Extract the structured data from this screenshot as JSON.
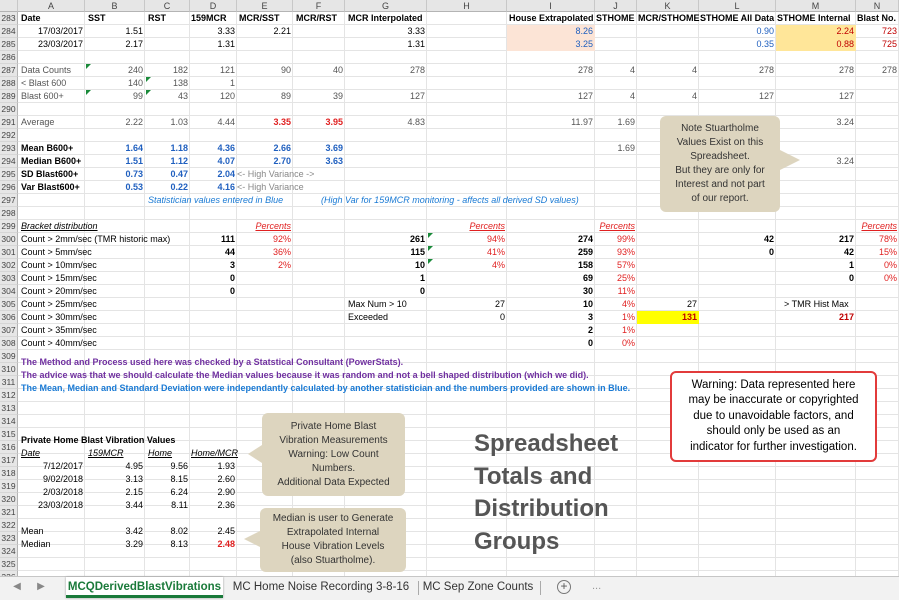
{
  "columns": [
    "A",
    "B",
    "C",
    "D",
    "E",
    "F",
    "G",
    "H",
    "I",
    "J",
    "K",
    "L",
    "M",
    "N"
  ],
  "rows": [
    "283",
    "284",
    "285",
    "286",
    "287",
    "288",
    "289",
    "290",
    "291",
    "292",
    "293",
    "294",
    "295",
    "296",
    "297",
    "298",
    "299",
    "300",
    "301",
    "302",
    "303",
    "304",
    "305",
    "306",
    "307",
    "308",
    "309",
    "310",
    "311",
    "312",
    "313",
    "314",
    "315",
    "316",
    "317",
    "318",
    "319",
    "320",
    "321",
    "322",
    "323",
    "324",
    "325",
    "326"
  ],
  "header": {
    "a": "Date",
    "b": "SST",
    "c": "RST",
    "d": "159MCR",
    "e": "MCR/SST",
    "f": "MCR/RST",
    "g": "MCR Interpolated",
    "i": "House Extrapolated",
    "j": "STHOME",
    "k": "MCR/STHOME",
    "l": "STHOME All Data",
    "m": "STHOME Internal",
    "n": "Blast No."
  },
  "r283": {
    "a": "17/03/2017",
    "b": "1.51",
    "d": "3.33",
    "e": "2.21",
    "g": "3.33",
    "i": "8.26",
    "l": "0.90",
    "m": "2.24",
    "n": "723"
  },
  "r284": {
    "a": "23/03/2017",
    "b": "2.17",
    "d": "1.31",
    "g": "1.31",
    "i": "3.25",
    "l": "0.35",
    "m": "0.88",
    "n": "725"
  },
  "r286": {
    "a": "Data Counts",
    "b": "240",
    "c": "182",
    "d": "121",
    "e": "90",
    "f": "40",
    "g": "278",
    "i": "278",
    "j": "4",
    "k": "4",
    "l": "278",
    "m": "278",
    "n": "278"
  },
  "r287": {
    "a": "< Blast 600",
    "b": "140",
    "c": "138",
    "d": "1"
  },
  "r288": {
    "a": "Blast 600+",
    "b": "99",
    "c": "43",
    "d": "120",
    "e": "89",
    "f": "39",
    "g": "127",
    "i": "127",
    "j": "4",
    "k": "4",
    "l": "127",
    "m": "127"
  },
  "r290": {
    "a": "Average",
    "b": "2.22",
    "c": "1.03",
    "d": "4.44",
    "e": "3.35",
    "f": "3.95",
    "g": "4.83",
    "i": "11.97",
    "j": "1.69",
    "m": "3.24"
  },
  "r292": {
    "a": "Mean B600+",
    "b": "1.64",
    "c": "1.18",
    "d": "4.36",
    "e": "2.66",
    "f": "3.69",
    "j": "1.69"
  },
  "r293": {
    "a": "Median B600+",
    "b": "1.51",
    "c": "1.12",
    "d": "4.07",
    "e": "2.70",
    "f": "3.63",
    "m": "3.24"
  },
  "r294": {
    "a": "SD Blast600+",
    "b": "0.73",
    "c": "0.47",
    "d": "2.04",
    "e": "<- High Variance ->"
  },
  "r295": {
    "a": "Var Blast600+",
    "b": "0.53",
    "c": "0.22",
    "d": "4.16",
    "e": "<- High Variance"
  },
  "r296": {
    "note": "Statistician values entered in Blue",
    "note2": "(High Var for 159MCR monitoring -  affects all derived SD values)"
  },
  "r298": {
    "a": "Bracket distribution",
    "d": "Percents",
    "h": "Percents",
    "j": "Percents",
    "n": "Percents"
  },
  "r299": {
    "a": "Count > 2mm/sec (TMR historic max)",
    "d": "111",
    "e": "92%",
    "g": "261",
    "h": "94%",
    "i": "274",
    "j": "99%",
    "l": "42",
    "m": "217",
    "n": "78%"
  },
  "r300": {
    "a": "Count > 5mm/sec",
    "d": "44",
    "e": "36%",
    "g": "115",
    "h": "41%",
    "i": "259",
    "j": "93%",
    "l": "0",
    "m": "42",
    "n": "15%"
  },
  "r301": {
    "a": "Count > 10mm/sec",
    "d": "3",
    "e": "2%",
    "g": "10",
    "h": "4%",
    "i": "158",
    "j": "57%",
    "m": "1",
    "n": "0%"
  },
  "r302": {
    "a": "Count > 15mm/sec",
    "d": "0",
    "g": "1",
    "i": "69",
    "j": "25%",
    "m": "0",
    "n": "0%"
  },
  "r303": {
    "a": "Count > 20mm/sec",
    "d": "0",
    "g": "0",
    "i": "30",
    "j": "11%"
  },
  "r304": {
    "a": "Count > 25mm/sec",
    "i": "10",
    "j": "4%"
  },
  "r305": {
    "a": "Count > 30mm/sec",
    "g": "Max Num > 10",
    "h": "27",
    "i": "3",
    "j": "1%",
    "k": "27",
    "m": "> TMR Hist Max"
  },
  "r306": {
    "a": "Count > 35mm/sec",
    "g": "Exceeded",
    "h": "0",
    "i": "2",
    "j": "1%",
    "k": "131",
    "m": "217"
  },
  "r307": {
    "a": "Count > 40mm/sec",
    "i": "0",
    "j": "0%"
  },
  "r309": "The Method and Process used here was checked by a Statstical Consultant (PowerStats).",
  "r310": "The advice was that we should calculate the Median values because it was random and not a bell shaped distribution (which we did).",
  "r311": "The Mean, Median and Standard Deviation were independantly calculated by another statistician and the numbers provided are shown in Blue.",
  "private": {
    "title": "Private Home Blast Vibration Values",
    "headers": [
      "Date",
      "159MCR",
      "Home",
      "Home/MCR"
    ],
    "rows": [
      [
        "7/12/2017",
        "4.95",
        "9.56",
        "1.93"
      ],
      [
        "9/02/2018",
        "3.13",
        "8.15",
        "2.60"
      ],
      [
        "2/03/2018",
        "2.15",
        "6.24",
        "2.90"
      ],
      [
        "23/03/2018",
        "3.44",
        "8.11",
        "2.36"
      ]
    ],
    "mean": [
      "Mean",
      "3.42",
      "8.02",
      "2.45"
    ],
    "median": [
      "Median",
      "3.29",
      "8.13",
      "2.48"
    ]
  },
  "callouts": {
    "stuart": [
      "Note Stuartholme",
      "Values Exist on this",
      "Spreadsheet.",
      "But they are only for",
      "Interest and not part",
      "of our report."
    ],
    "private": [
      "Private Home Blast",
      "Vibration Measurements",
      "Warning: Low Count",
      "Numbers.",
      "Additional Data Expected"
    ],
    "median": [
      "Median is user to Generate",
      "Extrapolated Internal",
      "House Vibration Levels",
      "(also Stuartholme)."
    ]
  },
  "big_title": [
    "Spreadsheet",
    "Totals and",
    "Distribution",
    "Groups"
  ],
  "warning": [
    "Warning: Data represented here",
    "may be inaccurate or copyrighted",
    "due to unavoidable factors, and",
    "should only be used as an",
    "indicator for further investigation."
  ],
  "tabs": {
    "active": "MCQDerivedBlastVibrations",
    "t2": "MC Home Noise Recording 3-8-16",
    "t3": "MC Sep Zone Counts",
    "add": "+",
    "dots": "..."
  },
  "colors": {
    "peach": "#fce4d6",
    "yellow_light": "#ffe699",
    "yellow": "#ffff00",
    "red": "#e02020",
    "blue": "#1f5fbf",
    "purple": "#7030a0",
    "statblue": "#1a7ad4",
    "green": "#1a7a3a"
  }
}
